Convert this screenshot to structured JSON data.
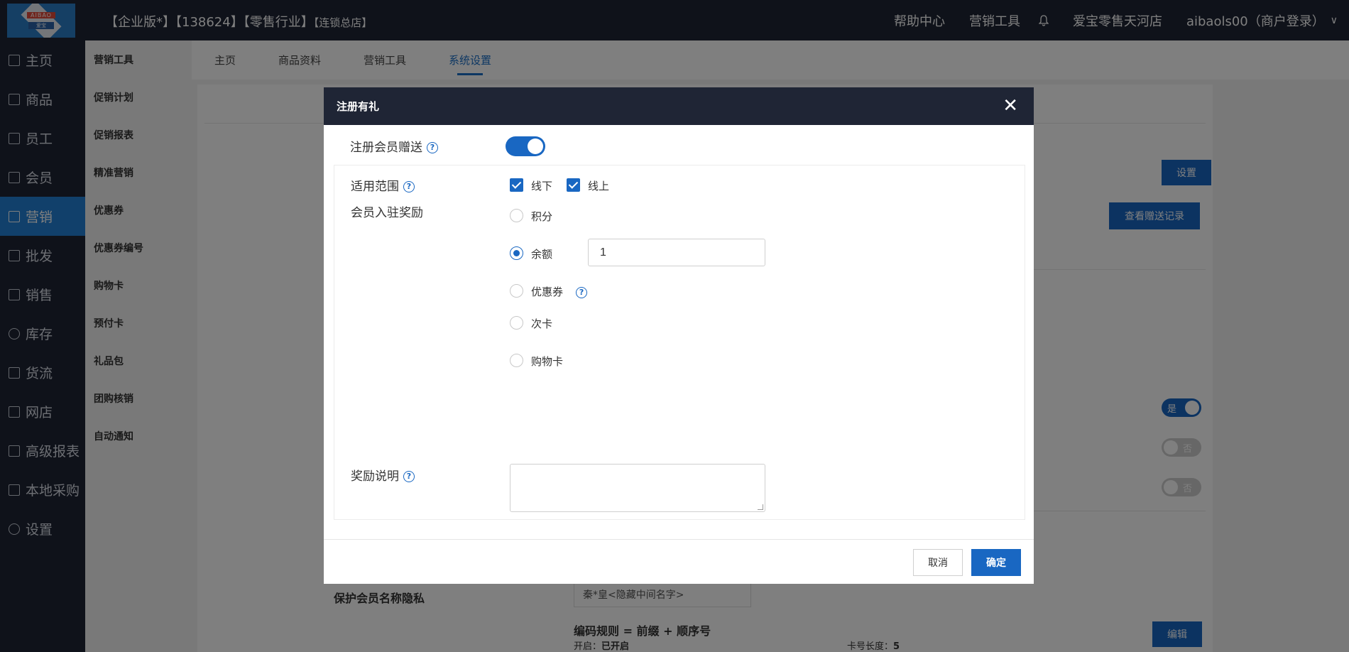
{
  "header": {
    "logo_top": "AIBAO",
    "logo_bottom": "爱宝",
    "edition": "【企业版*】",
    "account_no": "【138624】",
    "industry": "【零售行业】",
    "store_type": "【连锁总店】",
    "help": "帮助中心",
    "marketing": "营销工具",
    "store_name": "爱宝零售天河店",
    "user": "aibaols00（商户登录）",
    "chevron": "∨"
  },
  "sidebar": {
    "items": [
      {
        "label": "主页"
      },
      {
        "label": "商品"
      },
      {
        "label": "员工"
      },
      {
        "label": "会员"
      },
      {
        "label": "营销"
      },
      {
        "label": "批发"
      },
      {
        "label": "销售"
      },
      {
        "label": "库存"
      },
      {
        "label": "货流"
      },
      {
        "label": "网店"
      },
      {
        "label": "高级报表"
      },
      {
        "label": "本地采购"
      },
      {
        "label": "设置"
      }
    ]
  },
  "subsidebar": {
    "items": [
      {
        "label": "营销工具"
      },
      {
        "label": "促销计划"
      },
      {
        "label": "促销报表"
      },
      {
        "label": "精准营销"
      },
      {
        "label": "优惠券"
      },
      {
        "label": "优惠券编号"
      },
      {
        "label": "购物卡"
      },
      {
        "label": "预付卡"
      },
      {
        "label": "礼品包"
      },
      {
        "label": "团购核销"
      },
      {
        "label": "自动通知"
      }
    ]
  },
  "tabs": [
    {
      "label": "主页"
    },
    {
      "label": "商品资料"
    },
    {
      "label": "营销工具"
    },
    {
      "label": "系统设置"
    }
  ],
  "background": {
    "settings_btn": "设置",
    "view_gift_records_btn": "查看赠送记录",
    "toggle_yes": "是",
    "toggle_no": "否",
    "privacy_label": "保护会员名称隐私",
    "privacy_select": "秦*皇<隐藏中间名字>",
    "coding_rule": "编码规则 = 前缀 + 顺序号",
    "enabled_label": "开启：",
    "enabled_value": "已开启",
    "card_length_label": "卡号长度：",
    "card_length_value": "5",
    "edit_btn": "编辑"
  },
  "modal": {
    "title": "注册有礼",
    "close": "✕",
    "register_gift_label": "注册会员赠送",
    "scope_label": "适用范围",
    "scope_offline": "线下",
    "scope_online": "线上",
    "reward_label": "会员入驻奖励",
    "options": [
      {
        "label": "积分"
      },
      {
        "label": "余额"
      },
      {
        "label": "优惠券"
      },
      {
        "label": "次卡"
      },
      {
        "label": "购物卡"
      }
    ],
    "balance_value": "1",
    "desc_label": "奖励说明",
    "cancel": "取消",
    "confirm": "确定"
  }
}
